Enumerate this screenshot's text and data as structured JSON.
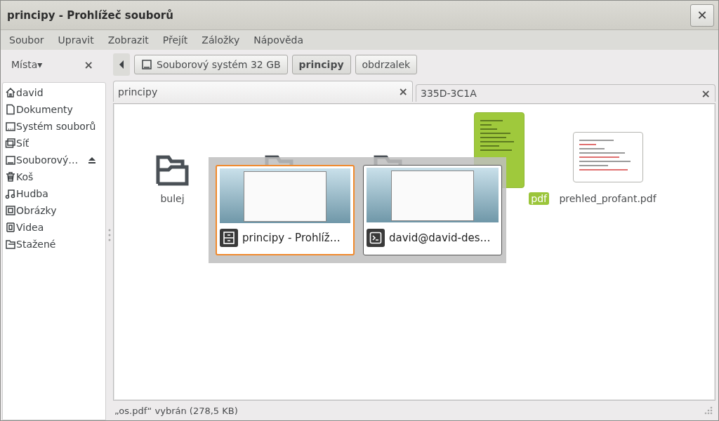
{
  "window": {
    "title": "principy - Prohlížeč souborů",
    "close": "✕"
  },
  "menu": [
    "Soubor",
    "Upravit",
    "Zobrazit",
    "Přejít",
    "Záložky",
    "Nápověda"
  ],
  "sidebar": {
    "title": "Místa",
    "arrow": "▾",
    "close": "×",
    "items": [
      {
        "label": "david",
        "kind": "home",
        "eject": false
      },
      {
        "label": "Dokumenty",
        "kind": "document",
        "eject": false
      },
      {
        "label": "Systém souborů",
        "kind": "drive",
        "eject": false
      },
      {
        "label": "Síť",
        "kind": "network",
        "eject": false
      },
      {
        "label": "Souborový…",
        "kind": "disk",
        "eject": true
      },
      {
        "label": "Koš",
        "kind": "trash",
        "eject": false
      },
      {
        "label": "Hudba",
        "kind": "music",
        "eject": false
      },
      {
        "label": "Obrázky",
        "kind": "pictures",
        "eject": false
      },
      {
        "label": "Videa",
        "kind": "video",
        "eject": false
      },
      {
        "label": "Stažené",
        "kind": "downloads",
        "eject": false
      }
    ]
  },
  "path": [
    {
      "label": "Souborový systém 32 GB",
      "selected": false,
      "kind": "disk"
    },
    {
      "label": "principy",
      "selected": true,
      "kind": "folder"
    },
    {
      "label": "obdrzalek",
      "selected": false,
      "kind": "folder"
    }
  ],
  "tabs": [
    {
      "label": "principy",
      "selected": true,
      "close": "×"
    },
    {
      "label": "335D-3C1A",
      "selected": false,
      "close": "×"
    }
  ],
  "files": [
    {
      "label": "bulej",
      "kind": "folder",
      "selected": false
    },
    {
      "kind": "folder",
      "selected": false
    },
    {
      "kind": "folder",
      "selected": false
    },
    {
      "label": "pdf",
      "kind": "pdf",
      "selected": true
    },
    {
      "label": "prehled_profant.pdf",
      "kind": "pdf",
      "selected": false
    }
  ],
  "switcher": [
    {
      "title": "principy - Prohlíž…",
      "kind": "filemanager",
      "selected": true
    },
    {
      "title": "david@david-des…",
      "kind": "terminal",
      "selected": false
    }
  ],
  "status_bar": "„os.pdf“ vybrán (278,5 KB)"
}
